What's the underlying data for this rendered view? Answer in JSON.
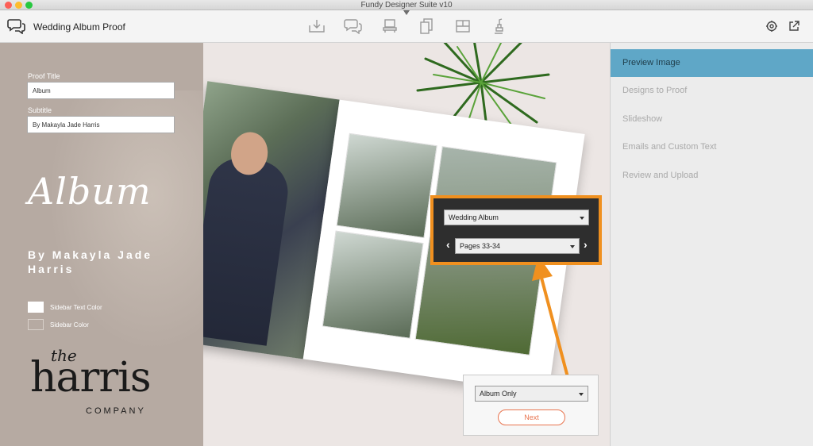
{
  "window": {
    "title": "Fundy Designer Suite v10"
  },
  "toolbar": {
    "app_name": "Wedding Album Proof",
    "tools": [
      {
        "icon": "design-icon"
      },
      {
        "icon": "proof-icon"
      },
      {
        "icon": "layout-icon"
      },
      {
        "icon": "pages-icon"
      },
      {
        "icon": "grid-icon"
      },
      {
        "icon": "export-icon"
      }
    ],
    "right_icons": [
      "settings-icon",
      "open-external-icon"
    ]
  },
  "sidebar": {
    "proof_title_label": "Proof Title",
    "proof_title_value": "Album",
    "subtitle_label": "Subtitle",
    "subtitle_value": "By Makayla Jade Harris",
    "display_title": "Album",
    "display_subtitle": "By Makayla Jade Harris",
    "sidebar_text_color_label": "Sidebar Text Color",
    "sidebar_color_label": "Sidebar Color",
    "sidebar_text_color": "#ffffff",
    "sidebar_color": "#b6aaa2",
    "logo": {
      "the": "the",
      "name": "harris",
      "company": "COMPANY"
    }
  },
  "preview": {
    "album_select": "Wedding Album",
    "pages_select": "Pages 33-34",
    "mode_select": "Album Only",
    "next_label": "Next",
    "highlight_color": "#f0901f"
  },
  "rightnav": {
    "items": [
      {
        "label": "Preview Image",
        "active": true
      },
      {
        "label": "Designs to Proof",
        "active": false
      },
      {
        "label": "Slideshow",
        "active": false
      },
      {
        "label": "Emails and Custom Text",
        "active": false
      },
      {
        "label": "Review and Upload",
        "active": false
      }
    ],
    "active_color": "#5fa7c7"
  }
}
